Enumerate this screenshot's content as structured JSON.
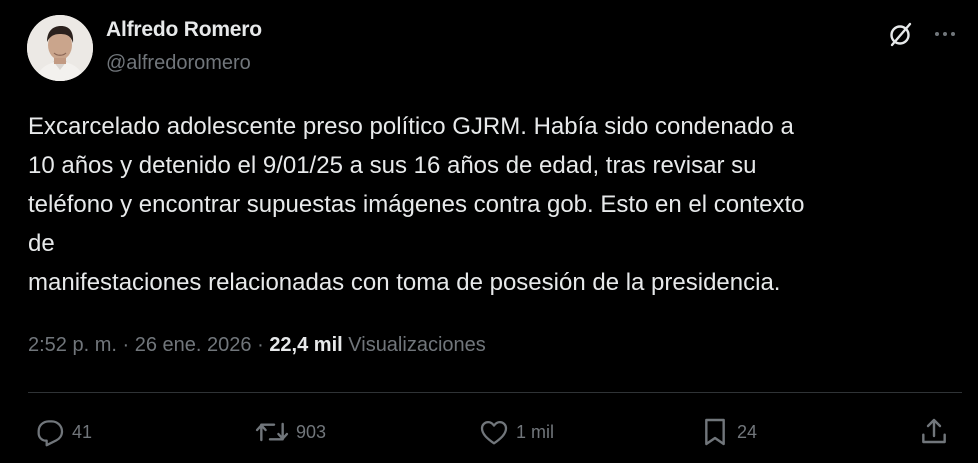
{
  "author": {
    "name": "Alfredo Romero",
    "handle": "@alfredoromero",
    "avatar_icon": "profile-photo"
  },
  "header_icons": {
    "grok": "grok-icon",
    "more": "more-horizontal-icon"
  },
  "tweet": {
    "text": "Excarcelado adolescente preso político GJRM. Había sido condenado a\n10 años y detenido el 9/01/25 a sus 16 años de edad, tras revisar su\nteléfono y encontrar supuestas imágenes contra gob. Esto en el contexto\nde\nmanifestaciones relacionadas con toma de posesión de la presidencia."
  },
  "meta": {
    "time": "2:52 p. m.",
    "separator": "·",
    "date": "26 ene. 2026",
    "views_count": "22,4 mil",
    "views_label": "Visualizaciones"
  },
  "actions": {
    "replies": {
      "count": "41",
      "icon": "reply-icon"
    },
    "reposts": {
      "count": "903",
      "icon": "repost-icon"
    },
    "likes": {
      "count": "1 mil",
      "icon": "like-icon"
    },
    "bookmarks": {
      "count": "24",
      "icon": "bookmark-icon"
    },
    "share": {
      "icon": "share-icon"
    }
  },
  "colors": {
    "background": "#000000",
    "text_primary": "#e7e9ea",
    "text_secondary": "#71767b",
    "divider": "#2f3336"
  }
}
